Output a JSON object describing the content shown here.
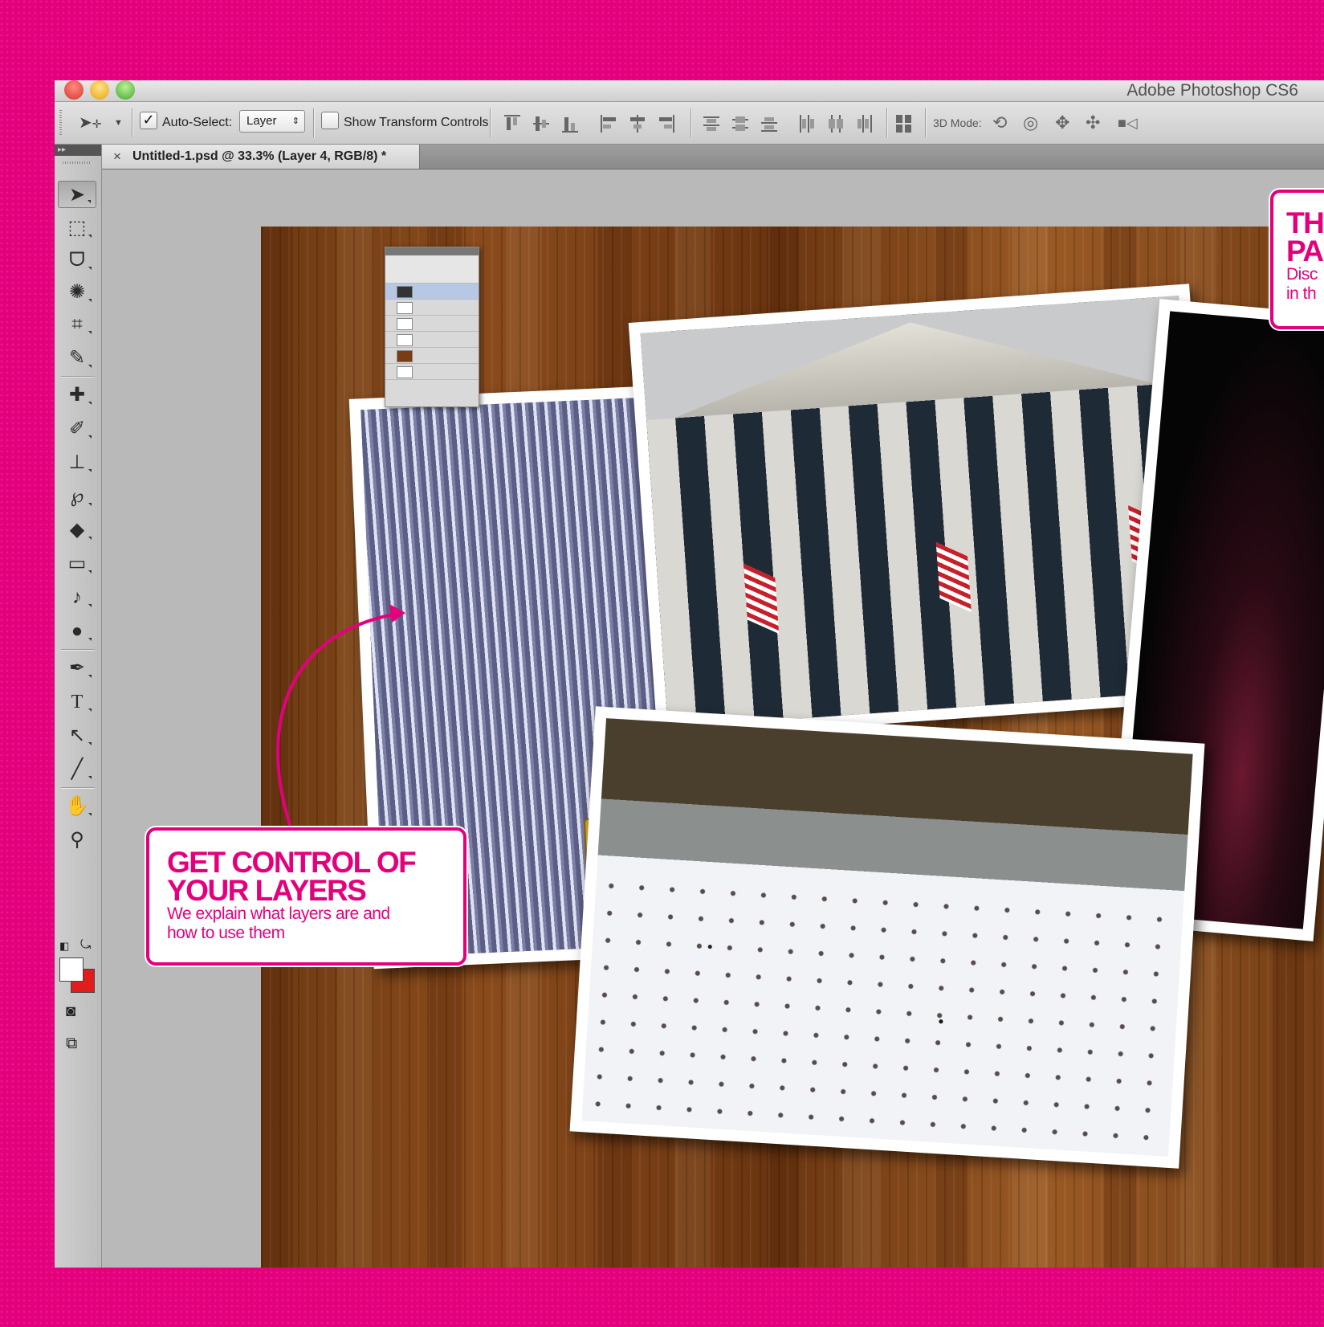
{
  "window": {
    "title": "Adobe Photoshop CS6",
    "controls": [
      "close",
      "minimize",
      "zoom"
    ]
  },
  "options_bar": {
    "tool_icon": "move-tool-icon",
    "auto_select_label": "Auto-Select:",
    "auto_select_checked": true,
    "auto_select_value": "Layer",
    "show_transform_label": "Show Transform Controls",
    "show_transform_checked": false,
    "mode_3d_label": "3D Mode:",
    "mode_3d_icons": [
      "rotate-3d-icon",
      "roll-3d-icon",
      "drag-3d-icon",
      "slide-3d-icon",
      "scale-3d-icon"
    ]
  },
  "document_tab": {
    "close_glyph": "×",
    "title": "Untitled-1.psd @ 33.3% (Layer 4, RGB/8) *"
  },
  "tools": [
    {
      "name": "move-tool",
      "glyph": "➤",
      "active": true
    },
    {
      "name": "marquee-tool",
      "glyph": "⬚"
    },
    {
      "name": "lasso-tool",
      "glyph": "ᗜ"
    },
    {
      "name": "quick-selection-tool",
      "glyph": "✺"
    },
    {
      "name": "crop-tool",
      "glyph": "⌗"
    },
    {
      "name": "eyedropper-tool",
      "glyph": "✎"
    },
    {
      "name": "healing-brush-tool",
      "glyph": "✚"
    },
    {
      "name": "brush-tool",
      "glyph": "✐"
    },
    {
      "name": "clone-stamp-tool",
      "glyph": "⊥"
    },
    {
      "name": "history-brush-tool",
      "glyph": "℘"
    },
    {
      "name": "eraser-tool",
      "glyph": "◆"
    },
    {
      "name": "gradient-tool",
      "glyph": "▭"
    },
    {
      "name": "blur-tool",
      "glyph": "♪"
    },
    {
      "name": "dodge-tool",
      "glyph": "●"
    },
    {
      "name": "pen-tool",
      "glyph": "✒"
    },
    {
      "name": "type-tool",
      "glyph": "T"
    },
    {
      "name": "path-selection-tool",
      "glyph": "↖"
    },
    {
      "name": "line-tool",
      "glyph": "╱"
    },
    {
      "name": "hand-tool",
      "glyph": "✋"
    },
    {
      "name": "zoom-tool",
      "glyph": "⚲"
    }
  ],
  "colors": {
    "foreground": "#ffffff",
    "background": "#e01c1c",
    "accent": "#e4007c"
  },
  "callouts": {
    "layers": {
      "heading_line1": "GET CONTROL OF",
      "heading_line2": "YOUR LAYERS",
      "body_line1": "We explain what layers are and",
      "body_line2": "how to use them"
    },
    "right": {
      "heading_line1": "TH",
      "heading_line2": "PA",
      "body_line1": "Disc",
      "body_line2": "in th"
    }
  }
}
